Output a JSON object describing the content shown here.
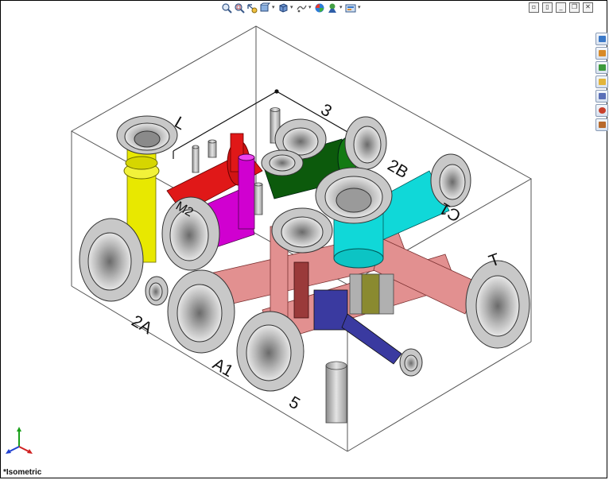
{
  "view": {
    "name": "*Isometric",
    "port_labels": {
      "L": "L",
      "3": "3",
      "2B": "2B",
      "C1": "C1",
      "T": "T",
      "2A": "2A",
      "A1": "A1",
      "5": "5",
      "M2": "M2"
    }
  },
  "toolbar": {
    "buttons": [
      {
        "icon": "zoom-to-fit-icon"
      },
      {
        "icon": "zoom-to-area-icon"
      },
      {
        "icon": "previous-view-icon"
      },
      {
        "icon": "section-view-icon"
      },
      {
        "icon": "view-orientation-icon"
      },
      {
        "icon": "display-style-icon"
      },
      {
        "icon": "hide-show-items-icon"
      },
      {
        "icon": "edit-appearance-icon"
      },
      {
        "icon": "apply-scene-icon"
      },
      {
        "icon": "view-settings-icon"
      }
    ]
  },
  "task_pane": {
    "tabs": [
      {
        "icon": "solidworks-resources-icon",
        "color": "#3a78c8"
      },
      {
        "icon": "design-library-icon",
        "color": "#d88a28"
      },
      {
        "icon": "file-explorer-icon",
        "color": "#3c9a3c"
      },
      {
        "icon": "search-folder-icon",
        "color": "#e2b43a"
      },
      {
        "icon": "view-palette-icon",
        "color": "#5a6fb8"
      },
      {
        "icon": "appearances-icon",
        "color": "#c8402c"
      },
      {
        "icon": "custom-properties-icon",
        "color": "#b86a2c"
      }
    ]
  },
  "colors": {
    "red": "#e01818",
    "salmon": "#e29090",
    "yellow": "#e8e800",
    "magenta": "#d000d0",
    "darkgreen": "#0c5a0c",
    "cyan": "#10d8d8",
    "maroon": "#9a3a3a",
    "navy": "#3a3aa0",
    "olive": "#8a8a30",
    "steel": "#c8c8c8"
  }
}
